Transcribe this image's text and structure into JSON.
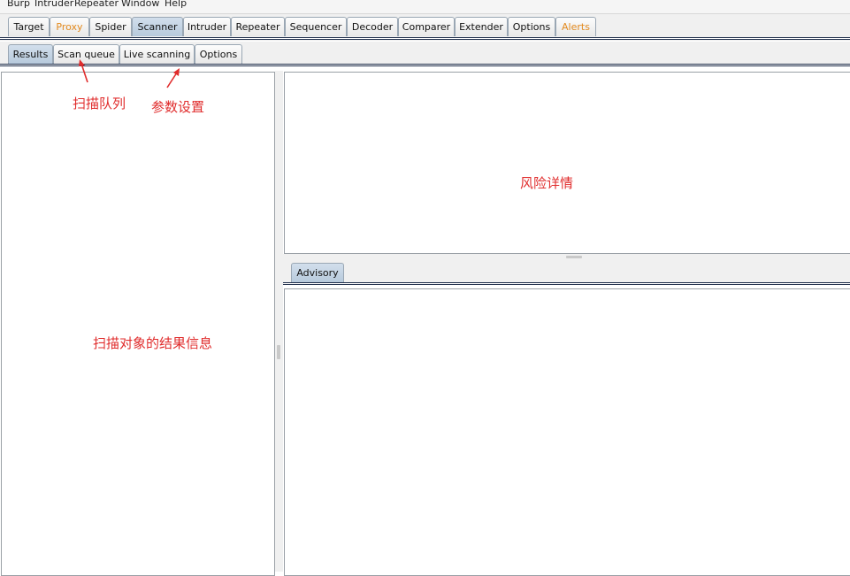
{
  "menu": [
    "Burp",
    "Intruder",
    "Repeater",
    "Window",
    "Help"
  ],
  "tabs": [
    {
      "label": "Target",
      "state": "normal"
    },
    {
      "label": "Proxy",
      "state": "alert"
    },
    {
      "label": "Spider",
      "state": "normal"
    },
    {
      "label": "Scanner",
      "state": "selected"
    },
    {
      "label": "Intruder",
      "state": "normal"
    },
    {
      "label": "Repeater",
      "state": "normal"
    },
    {
      "label": "Sequencer",
      "state": "normal"
    },
    {
      "label": "Decoder",
      "state": "normal"
    },
    {
      "label": "Comparer",
      "state": "normal"
    },
    {
      "label": "Extender",
      "state": "normal"
    },
    {
      "label": "Options",
      "state": "normal"
    },
    {
      "label": "Alerts",
      "state": "alert"
    }
  ],
  "subtabs": [
    {
      "label": "Results",
      "state": "selected"
    },
    {
      "label": "Scan queue",
      "state": "normal"
    },
    {
      "label": "Live scanning",
      "state": "normal"
    },
    {
      "label": "Options",
      "state": "normal"
    }
  ],
  "advisory_tab": "Advisory",
  "annotations": {
    "scan_queue": "扫描队列",
    "options": "参数设置",
    "risk_details": "风险详情",
    "results": "扫描对象的结果信息"
  },
  "colors": {
    "alert_tab_text": "#e38a1e",
    "selected_tab": "#b7cadc",
    "annotation": "#e02c2c"
  }
}
